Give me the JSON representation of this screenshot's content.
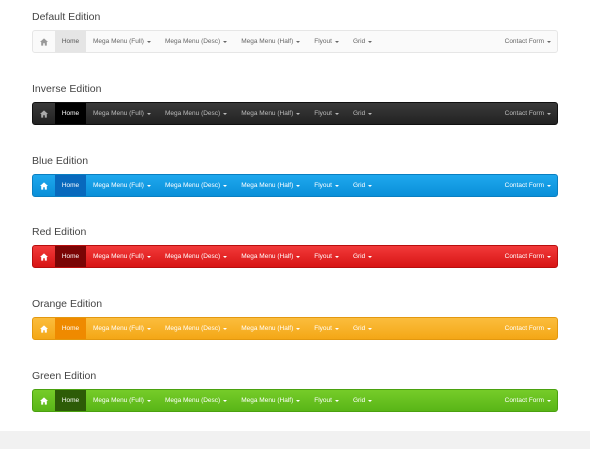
{
  "menu": {
    "home": "Home",
    "items": [
      "Mega Menu (Full)",
      "Mega Menu (Desc)",
      "Mega Menu (Half)",
      "Flyout",
      "Grid"
    ],
    "right": "Contact Form"
  },
  "sections": [
    {
      "title": "Default Edition",
      "accent": "#fafafa"
    },
    {
      "title": "Inverse Edition",
      "accent": "#222222"
    },
    {
      "title": "Blue Edition",
      "accent": "#0a8fd9"
    },
    {
      "title": "Red Edition",
      "accent": "#d71414"
    },
    {
      "title": "Orange Edition",
      "accent": "#f4a716"
    },
    {
      "title": "Green Edition",
      "accent": "#59b517"
    }
  ],
  "icons": {
    "home": "home-icon",
    "dropdown": "caret-down-icon"
  }
}
